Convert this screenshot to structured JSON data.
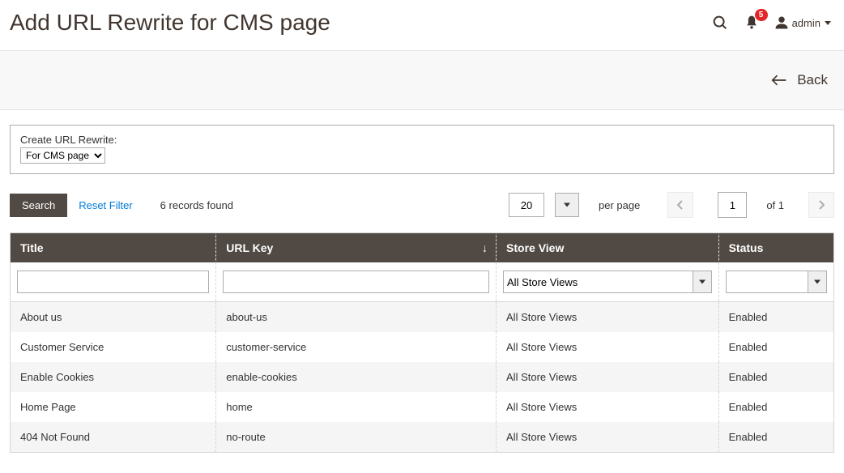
{
  "header": {
    "title": "Add URL Rewrite for CMS page",
    "notification_count": "5",
    "admin_label": "admin"
  },
  "toolbar": {
    "back_label": "Back"
  },
  "create": {
    "label": "Create URL Rewrite:",
    "selected": "For CMS page"
  },
  "grid": {
    "search_label": "Search",
    "reset_label": "Reset Filter",
    "records_found": "6 records found",
    "per_page_value": "20",
    "per_page_label": "per page",
    "page_current": "1",
    "page_total": "of 1",
    "columns": {
      "title": "Title",
      "url_key": "URL Key",
      "store_view": "Store View",
      "status": "Status"
    },
    "filter": {
      "store_view_selected": "All Store Views"
    },
    "rows": [
      {
        "title": "About us",
        "url_key": "about-us",
        "store_view": "All Store Views",
        "status": "Enabled"
      },
      {
        "title": "Customer Service",
        "url_key": "customer-service",
        "store_view": "All Store Views",
        "status": "Enabled"
      },
      {
        "title": "Enable Cookies",
        "url_key": "enable-cookies",
        "store_view": "All Store Views",
        "status": "Enabled"
      },
      {
        "title": "Home Page",
        "url_key": "home",
        "store_view": "All Store Views",
        "status": "Enabled"
      },
      {
        "title": "404 Not Found",
        "url_key": "no-route",
        "store_view": "All Store Views",
        "status": "Enabled"
      }
    ]
  }
}
